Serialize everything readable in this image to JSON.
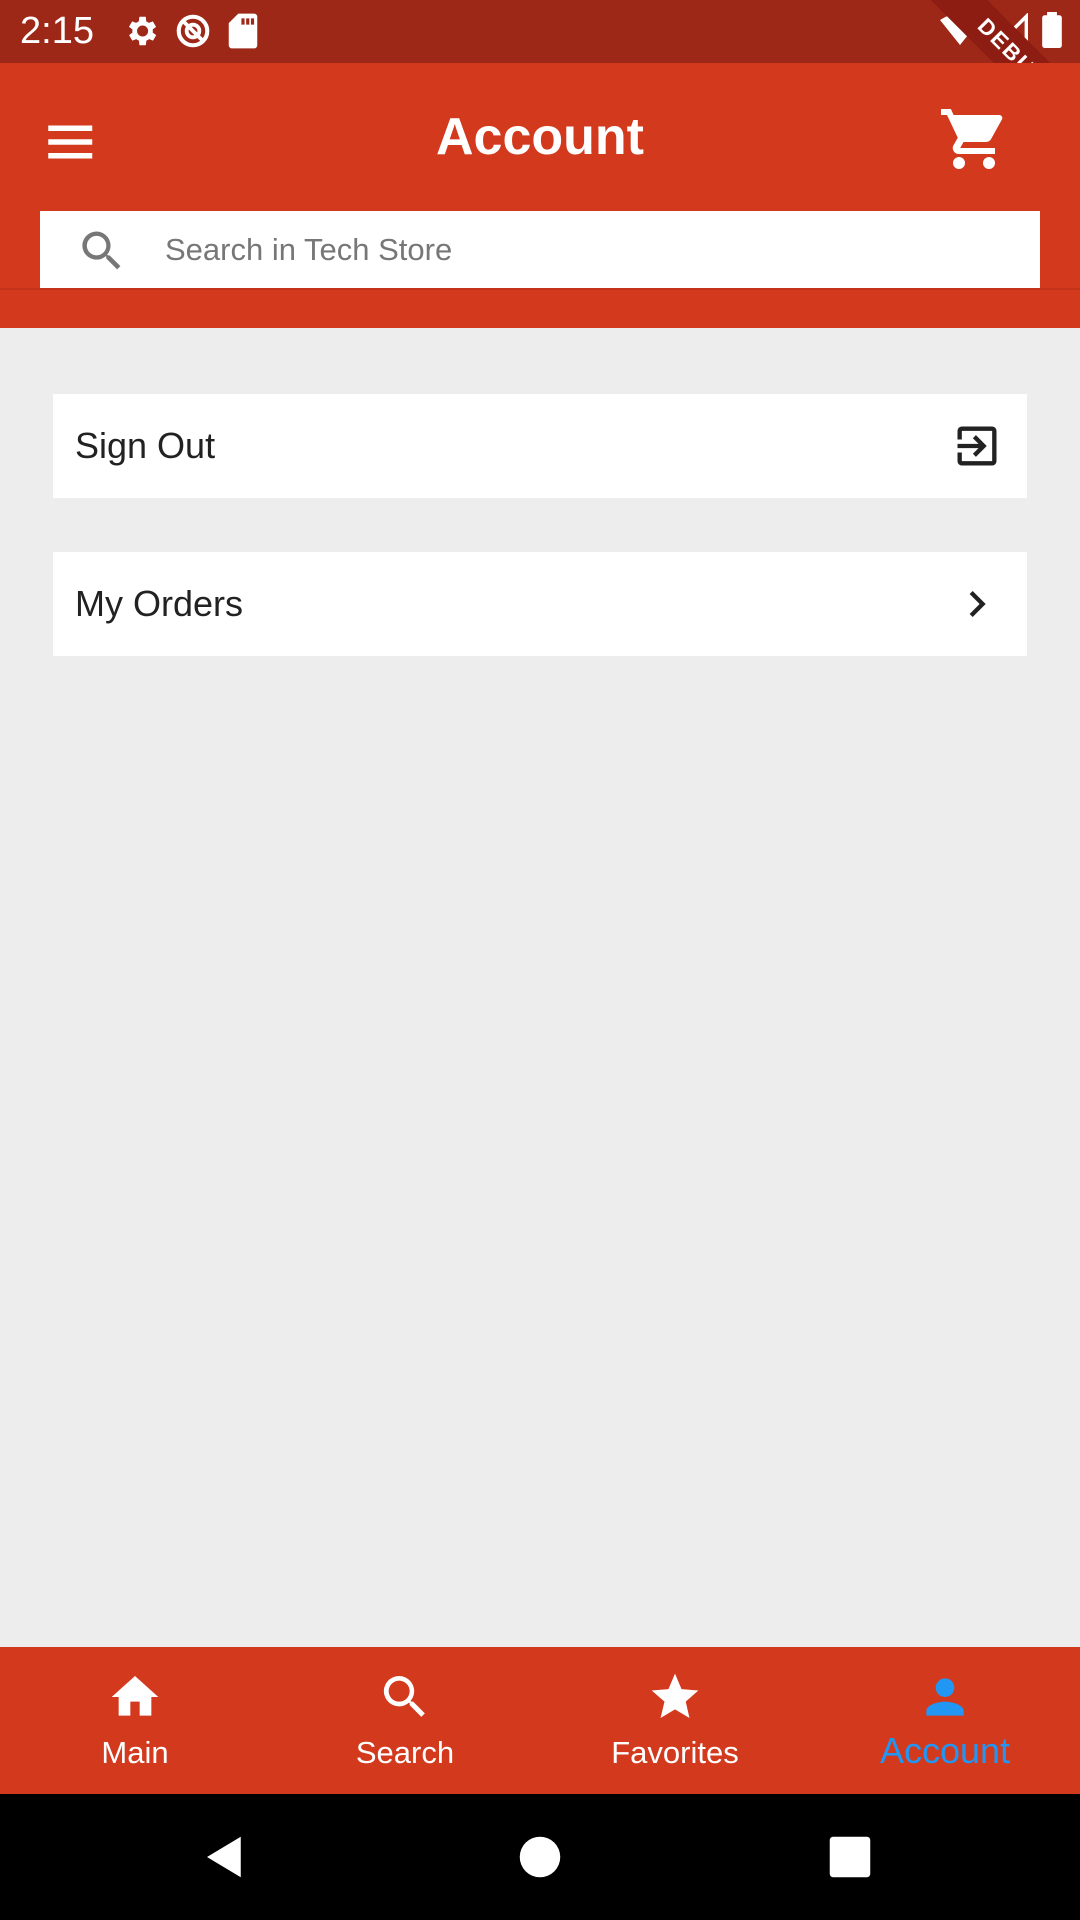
{
  "status_bar": {
    "time": "2:15"
  },
  "debug_banner": "DEBUG",
  "header": {
    "title": "Account"
  },
  "search": {
    "placeholder": "Search in Tech Store"
  },
  "menu": {
    "items": [
      {
        "label": "Sign Out",
        "icon": "exit-to-app-icon"
      },
      {
        "label": "My Orders",
        "icon": "chevron-right-icon"
      }
    ]
  },
  "bottom_nav": {
    "items": [
      {
        "label": "Main",
        "icon": "home-icon"
      },
      {
        "label": "Search",
        "icon": "search-icon"
      },
      {
        "label": "Favorites",
        "icon": "star-icon"
      },
      {
        "label": "Account",
        "icon": "person-icon",
        "active": true
      }
    ]
  },
  "colors": {
    "primary": "#d3391d",
    "status_bar": "#9e2818",
    "active_tab": "#2196f3",
    "background": "#ededed"
  }
}
